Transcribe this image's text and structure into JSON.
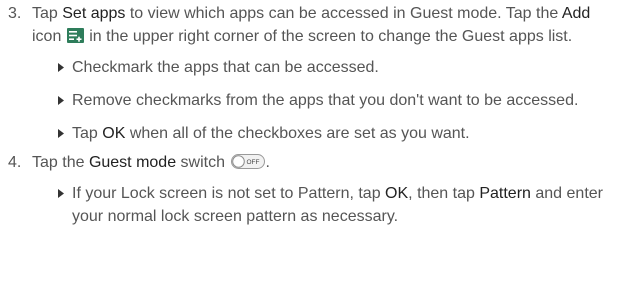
{
  "step3": {
    "number": "3.",
    "t1": "Tap ",
    "set_apps": "Set apps",
    "t2": " to view which apps can be accessed in Guest mode. Tap the ",
    "add": "Add",
    "t3": " icon ",
    "t4": " in the upper right corner of the screen to change the Guest apps list.",
    "add_icon": "add-list-icon",
    "bullets": [
      "Checkmark the apps that can be accessed.",
      "Remove checkmarks from the apps that you don't want to be accessed."
    ],
    "bullet3": {
      "t1": "Tap ",
      "ok": "OK",
      "t2": " when all of the checkboxes are set as you want."
    }
  },
  "step4": {
    "number": "4.",
    "t1": "Tap the ",
    "guest_mode": "Guest mode",
    "t2": " switch ",
    "switch_label": "OFF",
    "switch_icon": "toggle-switch-icon",
    "bullet": {
      "t1": "If your Lock screen is not set to Pattern, tap ",
      "ok": "OK",
      "t2": ", then tap ",
      "pattern": "Pattern",
      "t3": " and enter your normal lock screen pattern as necessary."
    }
  },
  "colors": {
    "text": "#555555",
    "emphasis": "#222222",
    "add_icon": "#2e7d5b"
  }
}
